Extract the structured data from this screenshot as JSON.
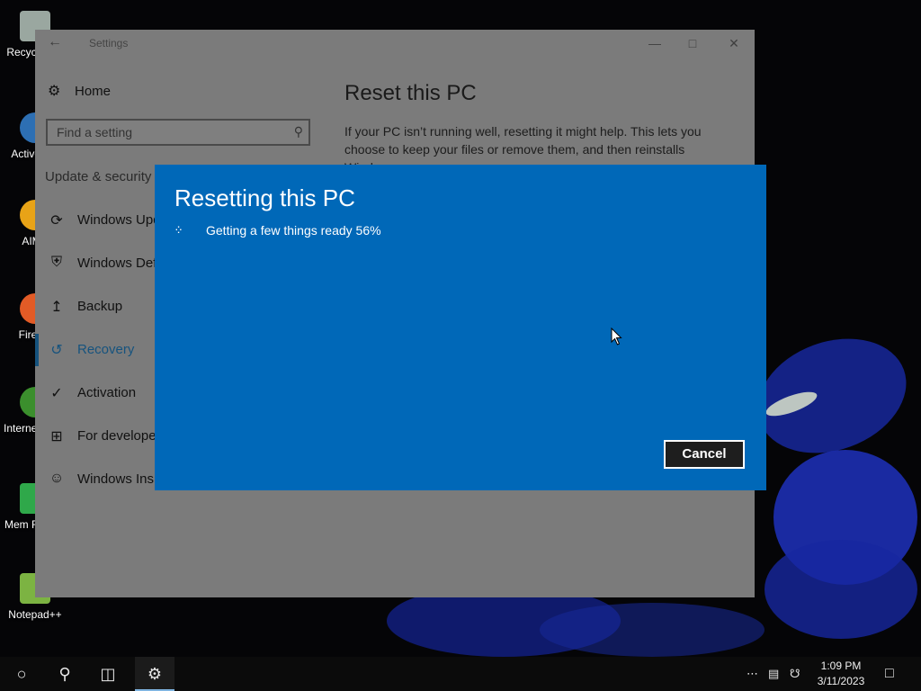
{
  "desktop": {
    "icons": [
      {
        "label": "Recycle Bin",
        "color": "#9aa7a0"
      },
      {
        "label": "ActiveWin",
        "color": "#2d6fb3"
      },
      {
        "label": "AIMP",
        "color": "#e8a317"
      },
      {
        "label": "Firefox",
        "color": "#e25b26"
      },
      {
        "label": "Internet Download",
        "color": "#3b8f2d"
      },
      {
        "label": "Mem Reduct",
        "color": "#2fa84a"
      },
      {
        "label": "Notepad++",
        "color": "#7cb342"
      }
    ]
  },
  "settings": {
    "title": "Settings",
    "back_icon": "back-arrow-icon",
    "home": "Home",
    "search_placeholder": "Find a setting",
    "section_title": "Update & security",
    "nav_items": [
      {
        "label": "Windows Update",
        "icon": "sync-icon"
      },
      {
        "label": "Windows Defender",
        "icon": "shield-icon"
      },
      {
        "label": "Backup",
        "icon": "backup-arrow-icon"
      },
      {
        "label": "Recovery",
        "icon": "recovery-icon"
      },
      {
        "label": "Activation",
        "icon": "check-circle-icon"
      },
      {
        "label": "For developers",
        "icon": "developer-tools-icon"
      },
      {
        "label": "Windows Insider Program",
        "icon": "insider-person-icon"
      }
    ],
    "content_title": "Reset this PC",
    "content_text": "If your PC isn’t running well, resetting it might help. This lets you choose to keep your files or remove them, and then reinstalls Windows."
  },
  "dialog": {
    "title": "Resetting this PC",
    "status": "Getting a few things ready 56%",
    "progress_percent": 56,
    "cancel_label": "Cancel",
    "accent": "#0068b8"
  },
  "taskbar": {
    "time": "1:09 PM",
    "date": "3/11/2023"
  }
}
